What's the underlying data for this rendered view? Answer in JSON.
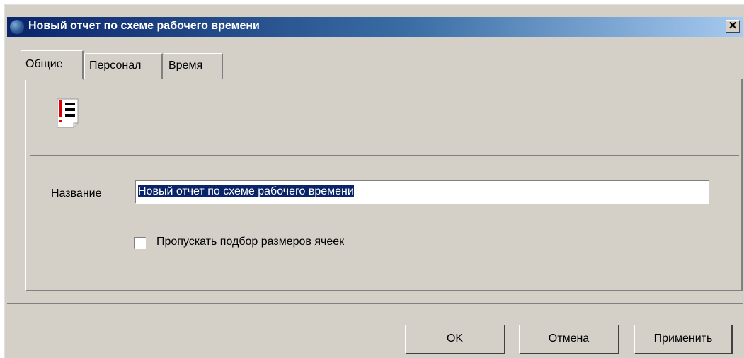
{
  "window": {
    "title": "Новый отчет по схеме рабочего времени",
    "close_glyph": "✕"
  },
  "tabs": [
    {
      "label": "Общие",
      "active": true
    },
    {
      "label": "Персонал",
      "active": false
    },
    {
      "label": "Время",
      "active": false
    }
  ],
  "general": {
    "icon": "report-list-icon",
    "name_label": "Название",
    "name_value": "Новый отчет по схеме рабочего времени",
    "skip_cell_sizing_label": "Пропускать подбор размеров ячеек",
    "skip_cell_sizing_checked": false
  },
  "buttons": {
    "ok": "OK",
    "cancel": "Отмена",
    "apply": "Применить"
  },
  "colors": {
    "titlebar_start": "#0a246a",
    "titlebar_end": "#a6caf0",
    "face": "#d4d0c8",
    "selection": "#0a246a"
  }
}
